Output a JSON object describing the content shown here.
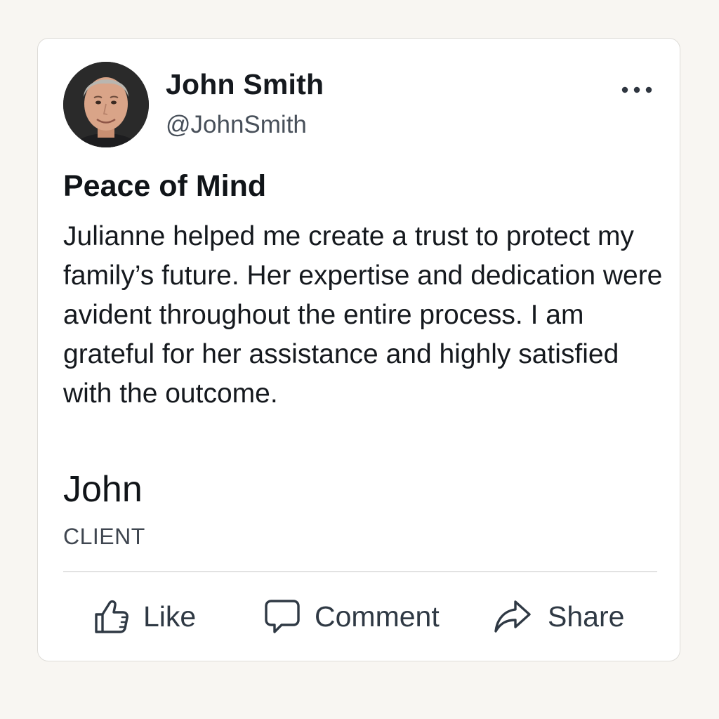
{
  "post": {
    "author": {
      "name": "John Smith",
      "handle": "@JohnSmith",
      "avatar_icon": "user-avatar-photo"
    },
    "menu_icon": "more-options-icon",
    "title": "Peace of Mind",
    "body": "Julianne helped me create a trust to protect my family’s future. Her expertise and dedication were avident throughout the entire process. I am grateful for her assistance and highly satisfied with the outcome.",
    "signature": "John",
    "role": "CLIENT"
  },
  "actions": {
    "like": {
      "label": "Like",
      "icon": "thumbs-up-icon"
    },
    "comment": {
      "label": "Comment",
      "icon": "speech-bubble-icon"
    },
    "share": {
      "label": "Share",
      "icon": "share-arrow-icon"
    }
  },
  "colors": {
    "background": "#f8f6f2",
    "card": "#ffffff",
    "text": "#15191e",
    "muted": "#48505a",
    "action": "#2f3944"
  }
}
